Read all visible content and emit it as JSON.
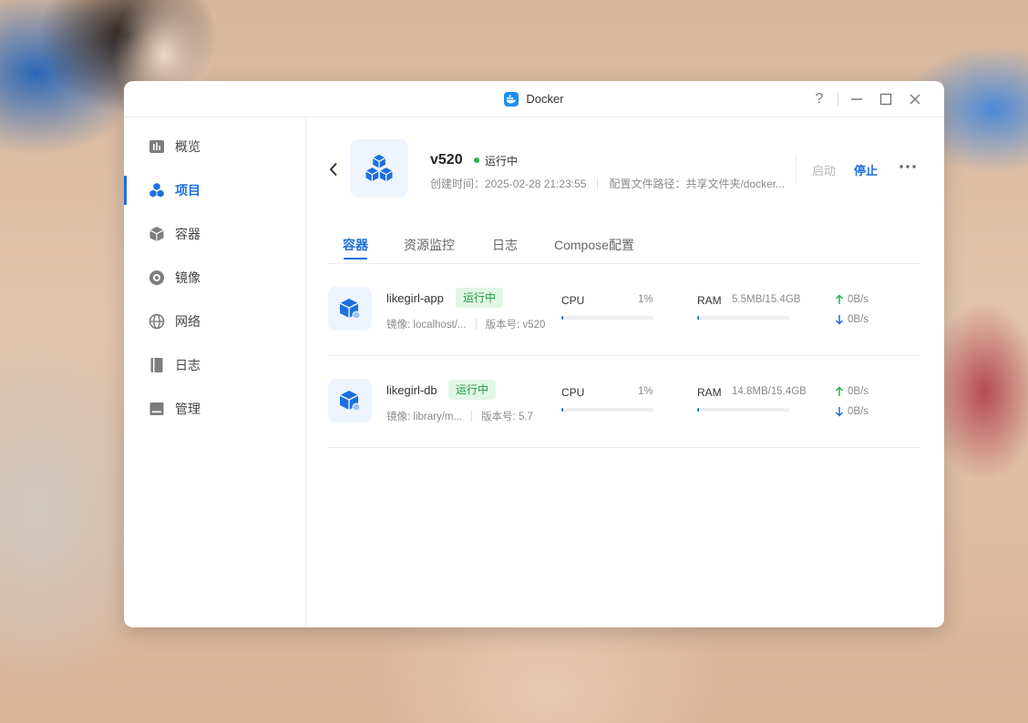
{
  "window": {
    "title": "Docker"
  },
  "sidebar": {
    "items": [
      {
        "label": "概览",
        "icon": "overview-icon"
      },
      {
        "label": "项目",
        "icon": "project-icon",
        "active": true
      },
      {
        "label": "容器",
        "icon": "container-icon"
      },
      {
        "label": "镜像",
        "icon": "image-icon"
      },
      {
        "label": "网络",
        "icon": "network-icon"
      },
      {
        "label": "日志",
        "icon": "log-icon"
      },
      {
        "label": "管理",
        "icon": "manage-icon"
      }
    ]
  },
  "project": {
    "name": "v520",
    "status": "运行中",
    "created": "创建时间：2025-02-28 21:23:55",
    "config_path": "配置文件路径：共享文件夹/docker...",
    "start_label": "启动",
    "stop_label": "停止"
  },
  "tabs": [
    "容器",
    "资源监控",
    "日志",
    "Compose配置"
  ],
  "containers": [
    {
      "name": "likegirl-app",
      "status": "运行中",
      "image": "镜像: localhost/...",
      "version": "版本号: v520",
      "cpu_label": "CPU",
      "cpu": "1%",
      "cpu_fraction": 0.01,
      "ram_label": "RAM",
      "ram": "5.5MB/15.4GB",
      "ram_fraction": 0.0004,
      "up": "0B/s",
      "down": "0B/s"
    },
    {
      "name": "likegirl-db",
      "status": "运行中",
      "image": "镜像: library/m...",
      "version": "版本号: 5.7",
      "cpu_label": "CPU",
      "cpu": "1%",
      "cpu_fraction": 0.01,
      "ram_label": "RAM",
      "ram": "14.8MB/15.4GB",
      "ram_fraction": 0.001,
      "up": "0B/s",
      "down": "0B/s"
    }
  ],
  "colors": {
    "accent": "#1d6fe0",
    "running": "#1c9a3b",
    "running_bg": "#e2f6e6",
    "up_arrow": "#27b44a",
    "down_arrow": "#1d6fe0"
  }
}
